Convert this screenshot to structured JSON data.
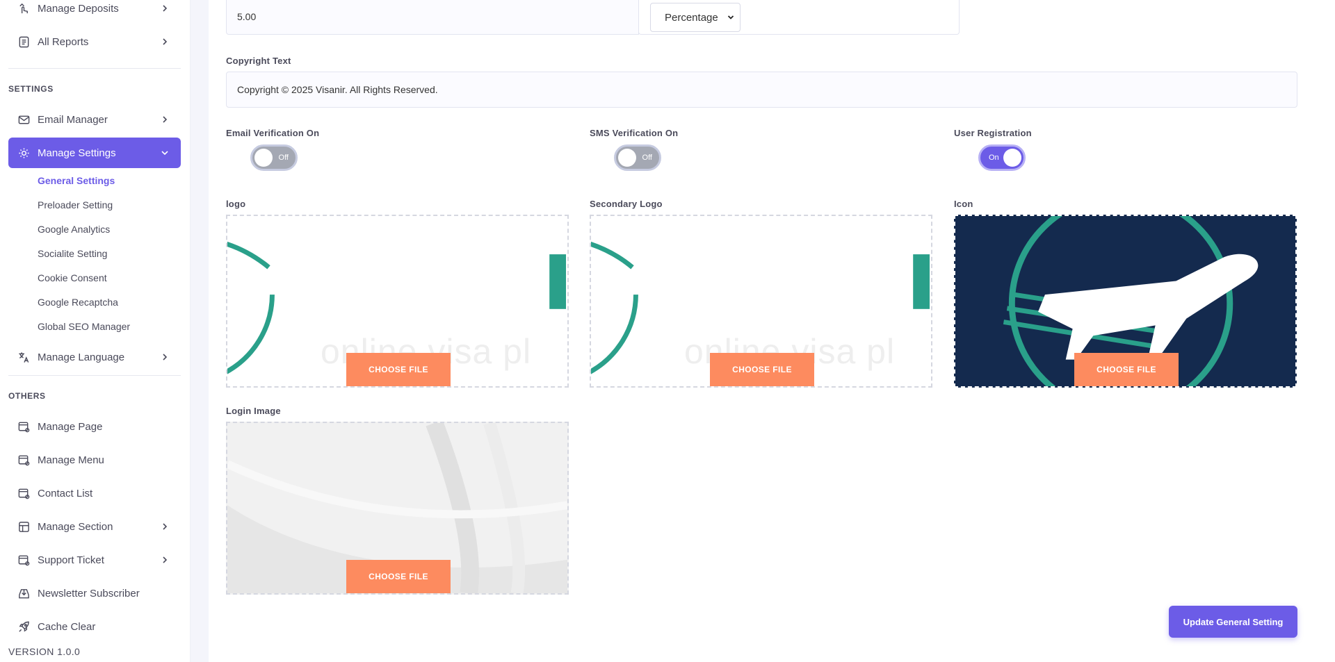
{
  "sidebar": {
    "top_items": [
      {
        "label": "Manage Deposits",
        "icon": "deposit-icon"
      },
      {
        "label": "All Reports",
        "icon": "report-icon"
      }
    ],
    "sections": {
      "settings": "SETTINGS",
      "others": "OTHERS"
    },
    "settings_items": [
      {
        "label": "Email Manager",
        "icon": "email-icon"
      },
      {
        "label": "Manage Settings",
        "icon": "settings-icon"
      },
      {
        "label": "Manage Language",
        "icon": "language-icon"
      }
    ],
    "settings_sub_items": [
      "General Settings",
      "Preloader Setting",
      "Google Analytics",
      "Socialite Setting",
      "Cookie Consent",
      "Google Recaptcha",
      "Global SEO Manager"
    ],
    "others_items": [
      {
        "label": "Manage Page",
        "icon": "page-icon"
      },
      {
        "label": "Manage Menu",
        "icon": "menu-icon"
      },
      {
        "label": "Contact List",
        "icon": "contact-icon"
      },
      {
        "label": "Manage Section",
        "icon": "section-icon"
      },
      {
        "label": "Support Ticket",
        "icon": "ticket-icon"
      },
      {
        "label": "Newsletter Subscriber",
        "icon": "newsletter-icon"
      },
      {
        "label": "Cache Clear",
        "icon": "rocket-icon"
      }
    ],
    "version": "VERSION 1.0.0"
  },
  "form": {
    "charge_value": "5.00",
    "charge_type": "Percentage",
    "copyright_label": "Copyright Text",
    "copyright_value": "Copyright © 2025 Visanir. All Rights Reserved.",
    "toggles": [
      {
        "label": "Email Verification On",
        "state": "Off"
      },
      {
        "label": "SMS Verification On",
        "state": "Off"
      },
      {
        "label": "User Registration",
        "state": "On"
      }
    ],
    "uploads": [
      {
        "label": "logo",
        "button": "CHOOSE FILE"
      },
      {
        "label": "Secondary Logo",
        "button": "CHOOSE FILE"
      },
      {
        "label": "Icon",
        "button": "CHOOSE FILE"
      },
      {
        "label": "Login Image",
        "button": "CHOOSE FILE"
      }
    ],
    "logo_watermark": "online visa pl",
    "submit_label": "Update General Setting"
  },
  "colors": {
    "accent": "#6c5ce7",
    "upload_button": "#fd8b5f",
    "logo_teal": "#2aa08a",
    "icon_bg": "#142a4e"
  }
}
